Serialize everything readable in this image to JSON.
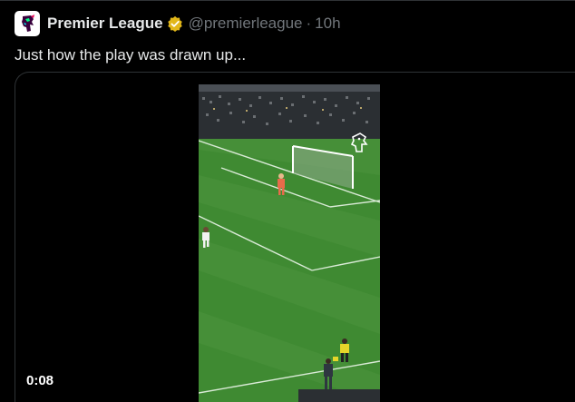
{
  "author": {
    "name": "Premier League",
    "handle": "@premierleague",
    "separator": "·",
    "time": "10h",
    "verified_icon": "verified-gold-badge-icon",
    "avatar_icon": "premier-league-lion-logo"
  },
  "tweet": {
    "text": "Just how the play was drawn up..."
  },
  "video": {
    "duration": "0:08",
    "watermark_icon": "premier-league-lion-watermark-icon"
  },
  "colors": {
    "background": "#000000",
    "text_primary": "#e7e9ea",
    "text_secondary": "#71767b",
    "verified_gold": "#e2b719",
    "pitch_green": "#3f8a32"
  }
}
